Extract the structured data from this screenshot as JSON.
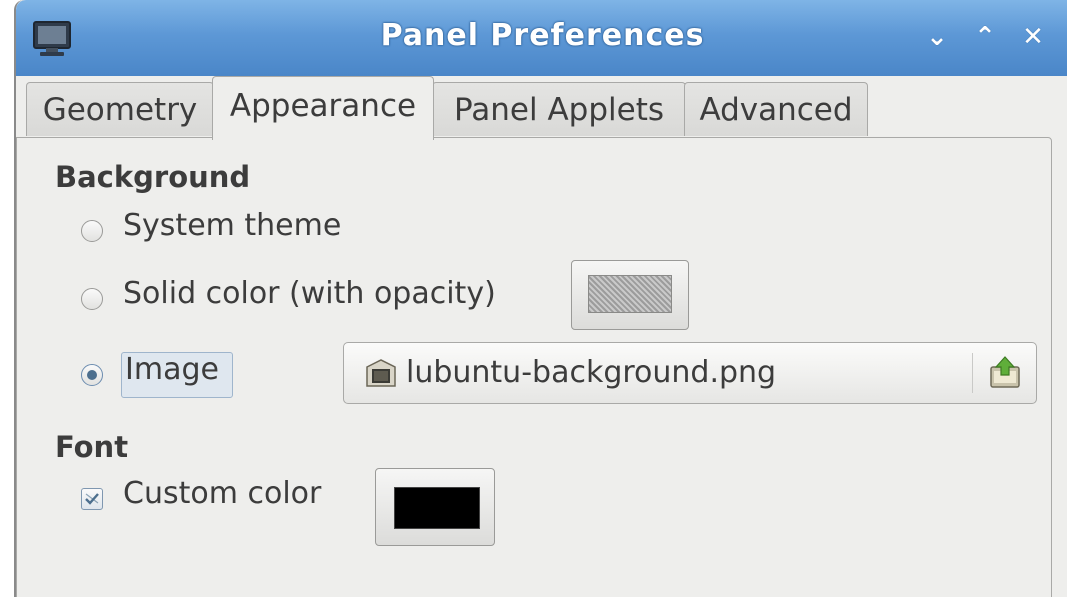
{
  "window": {
    "title": "Panel Preferences",
    "controls": {
      "minimize": "⌄",
      "maximize": "⌃",
      "close": "✕"
    }
  },
  "tabs": [
    {
      "label": "Geometry",
      "active": false
    },
    {
      "label": "Appearance",
      "active": true
    },
    {
      "label": "Panel Applets",
      "active": false
    },
    {
      "label": "Advanced",
      "active": false
    }
  ],
  "background": {
    "heading": "Background",
    "options": [
      {
        "label": "System theme",
        "selected": false
      },
      {
        "label": "Solid color (with opacity)",
        "selected": false
      },
      {
        "label": "Image",
        "selected": true
      }
    ],
    "image_file": "lubuntu-background.png"
  },
  "font": {
    "heading": "Font",
    "custom_color_label": "Custom color",
    "custom_color_checked": true,
    "custom_color_value": "#000000"
  },
  "colors": {
    "titlebar": "#5d98d6",
    "window_bg": "#eeeeec",
    "text": "#3c3c3c"
  }
}
